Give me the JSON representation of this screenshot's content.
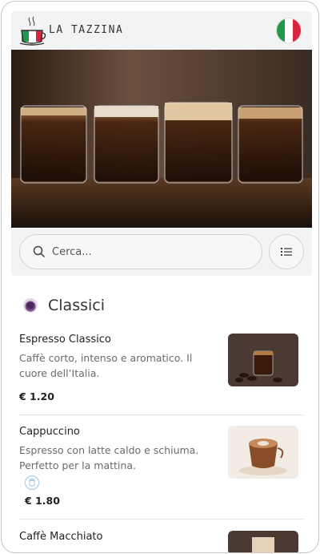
{
  "header": {
    "brand": "LA TAZZINA",
    "flag_colors": [
      "#1f9a48",
      "#ffffff",
      "#d7263d"
    ]
  },
  "search": {
    "placeholder": "Cerca..."
  },
  "section": {
    "title": "Classici"
  },
  "items": [
    {
      "name": "Espresso Classico",
      "description": "Caffè corto, intenso e aromatico. Il cuore dell’Italia.",
      "price": "€ 1.20"
    },
    {
      "name": "Cappuccino",
      "description": "Espresso con latte caldo e schiuma. Perfetto per la mattina.",
      "price": "€ 1.80"
    },
    {
      "name": "Caffè Macchiato",
      "description": "",
      "price": ""
    }
  ],
  "colors": {
    "panel": "#f2f3f5",
    "accent_purple": "#7b4b8a",
    "tag_blue": "#9ec6e8"
  }
}
